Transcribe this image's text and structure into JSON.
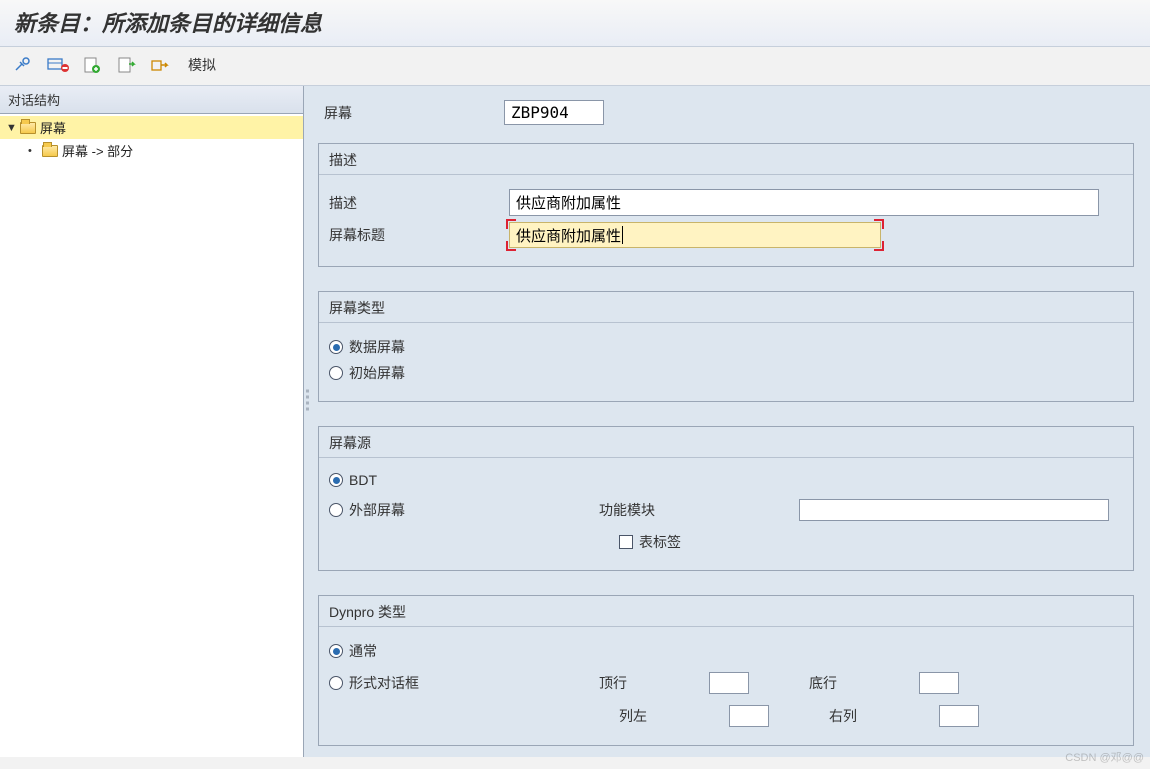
{
  "title": "新条目：所添加条目的详细信息",
  "toolbar": {
    "simulate_label": "模拟"
  },
  "sidebar": {
    "header": "对话结构",
    "items": [
      {
        "label": "屏幕"
      },
      {
        "label": "屏幕 -> 部分"
      }
    ]
  },
  "main": {
    "screen_label": "屏幕",
    "screen_value": "ZBP904",
    "groups": {
      "desc": {
        "title": "描述",
        "desc_label": "描述",
        "desc_value": "供应商附加属性",
        "title_label": "屏幕标题",
        "title_value": "供应商附加属性"
      },
      "screen_type": {
        "title": "屏幕类型",
        "opt1": "数据屏幕",
        "opt2": "初始屏幕"
      },
      "screen_source": {
        "title": "屏幕源",
        "opt1": "BDT",
        "opt2": "外部屏幕",
        "func_label": "功能模块",
        "tab_label": "表标签"
      },
      "dynpro": {
        "title": "Dynpro 类型",
        "opt1": "通常",
        "opt2": "形式对话框",
        "top_label": "顶行",
        "bot_label": "底行",
        "left_label": "列左",
        "right_label": "右列"
      }
    }
  },
  "watermark": "CSDN @邓@@"
}
